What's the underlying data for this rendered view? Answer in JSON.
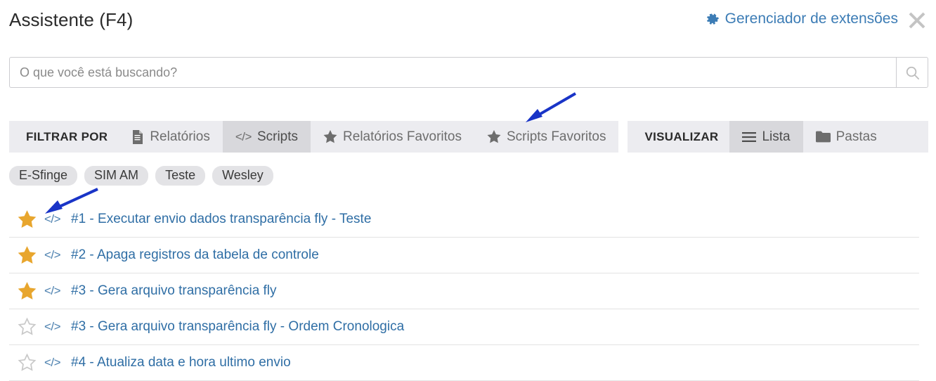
{
  "header": {
    "title": "Assistente (F4)",
    "extensions_manager_label": "Gerenciador de extensões",
    "gear_icon": "gear-icon",
    "close_icon": "close-icon"
  },
  "search": {
    "value": "",
    "placeholder": "O que você está buscando?",
    "search_icon": "search-icon"
  },
  "toolbar": {
    "filter_label": "FILTRAR POR",
    "filter_items": [
      {
        "label": "Relatórios",
        "icon": "document-icon",
        "active": false
      },
      {
        "label": "Scripts",
        "icon": "code-icon",
        "active": true
      },
      {
        "label": "Relatórios Favoritos",
        "icon": "star-icon",
        "active": false
      },
      {
        "label": "Scripts Favoritos",
        "icon": "star-icon",
        "active": false
      }
    ],
    "view_label": "VISUALIZAR",
    "view_items": [
      {
        "label": "Lista",
        "icon": "list-icon",
        "active": true
      },
      {
        "label": "Pastas",
        "icon": "folder-icon",
        "active": false
      }
    ]
  },
  "tags": [
    "E-Sfinge",
    "SIM AM",
    "Teste",
    "Wesley"
  ],
  "list": {
    "code_icon": "code-icon",
    "items": [
      {
        "favorite": true,
        "label": "#1 - Executar envio dados transparência fly - Teste"
      },
      {
        "favorite": true,
        "label": "#2 - Apaga registros da tabela de controle"
      },
      {
        "favorite": true,
        "label": "#3 - Gera arquivo transparência fly"
      },
      {
        "favorite": false,
        "label": "#3 - Gera arquivo transparência fly - Ordem Cronologica"
      },
      {
        "favorite": false,
        "label": "#4 - Atualiza data e hora ultimo envio"
      }
    ]
  },
  "annotations": [
    {
      "name": "arrow-to-scripts-favoritos"
    },
    {
      "name": "arrow-to-first-favorite-star"
    }
  ],
  "colors": {
    "link": "#2f6ea5",
    "star_active": "#e8a62e",
    "star_inactive": "#c9c9c9",
    "toolbar_bg": "#ececf0",
    "toolbar_active_bg": "#d8d8dc",
    "chip_bg": "#e3e3e6",
    "annotation": "#1934c7"
  }
}
